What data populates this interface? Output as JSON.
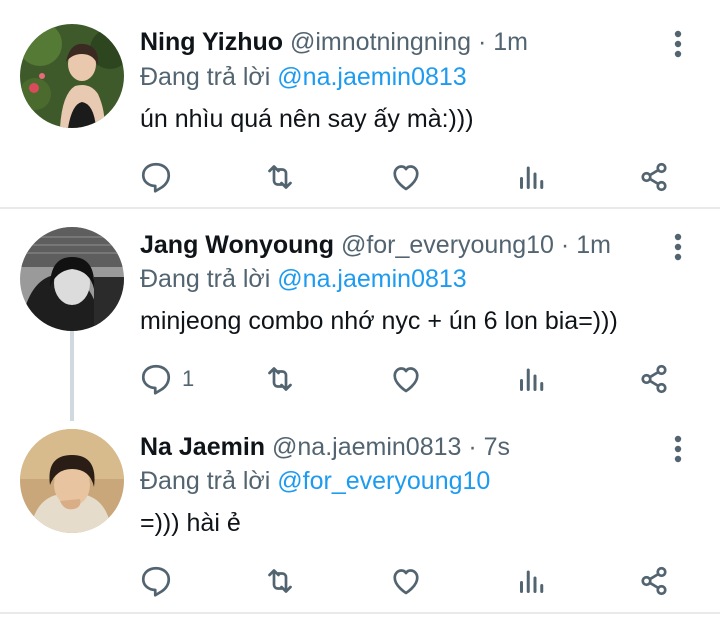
{
  "tweets": [
    {
      "name": "Ning Yizhuo",
      "handle": "@imnotningning",
      "dot": "·",
      "time": "1m",
      "reply_prefix": "Đang trả lời",
      "reply_to": "@na.jaemin0813",
      "text": "ún nhìu quá nên say ấy mà:)))",
      "reply_count": ""
    },
    {
      "name": "Jang Wonyoung",
      "handle": "@for_everyoung10",
      "dot": "·",
      "time": "1m",
      "reply_prefix": "Đang trả lời",
      "reply_to": "@na.jaemin0813",
      "text": "minjeong combo nhớ nyc + ún 6 lon bia=)))",
      "reply_count": "1"
    },
    {
      "name": "Na Jaemin",
      "handle": "@na.jaemin0813",
      "dot": "·",
      "time": "7s",
      "reply_prefix": "Đang trả lời",
      "reply_to": "@for_everyoung10",
      "text": "=))) hài ẻ",
      "reply_count": ""
    }
  ],
  "colors": {
    "text": "#0f1419",
    "secondary": "#536471",
    "accent": "#1d9bf0",
    "divider": "#e7e9ea"
  },
  "icons": [
    "more-icon",
    "reply-icon",
    "retweet-icon",
    "like-icon",
    "analytics-icon",
    "share-icon"
  ]
}
